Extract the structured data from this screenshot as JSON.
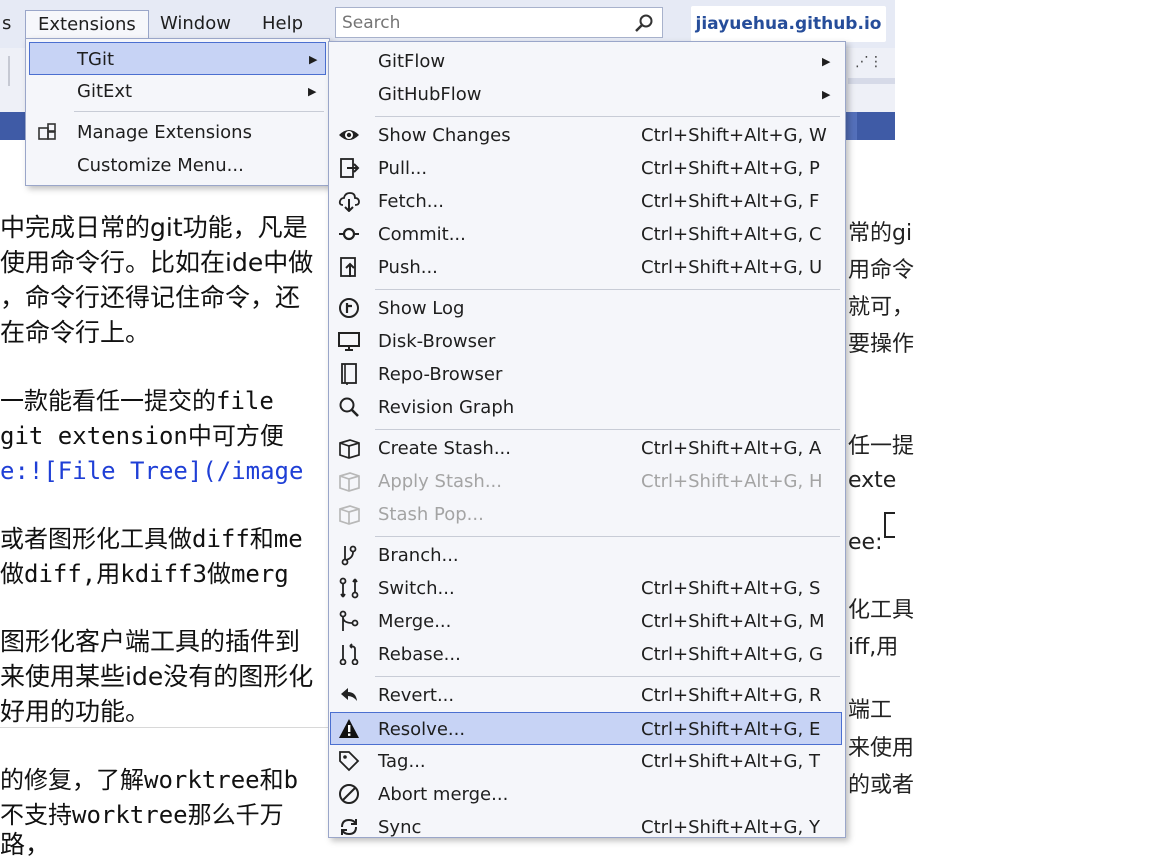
{
  "menubar": {
    "partial_left": "s",
    "items": [
      "Extensions",
      "Window",
      "Help"
    ],
    "search_placeholder": "Search",
    "badge": "jiayuehua.github.io"
  },
  "extensions_menu": {
    "items": [
      {
        "label": "TGit",
        "submenu": true,
        "highlighted": true
      },
      {
        "label": "GitExt",
        "submenu": true
      },
      {
        "label": "Manage Extensions",
        "icon": "extensions-icon"
      },
      {
        "label": "Customize Menu..."
      }
    ]
  },
  "tgit_menu": {
    "items": [
      {
        "label": "GitFlow",
        "submenu": true
      },
      {
        "label": "GitHubFlow",
        "submenu": true
      },
      {
        "label": "Show Changes",
        "shortcut": "Ctrl+Shift+Alt+G, W",
        "icon": "eye-icon"
      },
      {
        "label": "Pull...",
        "shortcut": "Ctrl+Shift+Alt+G, P",
        "icon": "pull-icon"
      },
      {
        "label": "Fetch...",
        "shortcut": "Ctrl+Shift+Alt+G, F",
        "icon": "cloud-download-icon"
      },
      {
        "label": "Commit...",
        "shortcut": "Ctrl+Shift+Alt+G, C",
        "icon": "commit-icon"
      },
      {
        "label": "Push...",
        "shortcut": "Ctrl+Shift+Alt+G, U",
        "icon": "push-icon"
      },
      {
        "label": "Show Log",
        "icon": "log-icon"
      },
      {
        "label": "Disk-Browser",
        "icon": "monitor-icon"
      },
      {
        "label": "Repo-Browser",
        "icon": "book-icon"
      },
      {
        "label": "Revision Graph",
        "icon": "magnifier-icon"
      },
      {
        "label": "Create Stash...",
        "shortcut": "Ctrl+Shift+Alt+G, A",
        "icon": "box-icon"
      },
      {
        "label": "Apply Stash...",
        "shortcut": "Ctrl+Shift+Alt+G, H",
        "icon": "box-icon",
        "disabled": true
      },
      {
        "label": "Stash Pop...",
        "icon": "box-icon",
        "disabled": true
      },
      {
        "label": "Branch...",
        "icon": "branch-icon"
      },
      {
        "label": "Switch...",
        "shortcut": "Ctrl+Shift+Alt+G, S",
        "icon": "switch-icon"
      },
      {
        "label": "Merge...",
        "shortcut": "Ctrl+Shift+Alt+G, M",
        "icon": "merge-icon"
      },
      {
        "label": "Rebase...",
        "shortcut": "Ctrl+Shift+Alt+G, G",
        "icon": "rebase-icon"
      },
      {
        "label": "Revert...",
        "shortcut": "Ctrl+Shift+Alt+G, R",
        "icon": "revert-icon"
      },
      {
        "label": "Resolve...",
        "shortcut": "Ctrl+Shift+Alt+G, E",
        "icon": "warning-icon",
        "highlighted": true
      },
      {
        "label": "Tag...",
        "shortcut": "Ctrl+Shift+Alt+G, T",
        "icon": "tag-icon"
      },
      {
        "label": "Abort merge...",
        "icon": "abort-icon"
      },
      {
        "label": "Sync",
        "shortcut": "Ctrl+Shift+Alt+G, Y",
        "icon": "sync-icon"
      }
    ]
  },
  "document": {
    "left_lines": [
      "中完成日常的git功能，凡是",
      "使用命令行。比如在ide中做",
      "，命令行还得记住命令，还",
      "在命令行上。",
      "一款能看任一提交的file",
      "git extension中可方便",
      "e:![File Tree](/image",
      "或者图形化工具做diff和me",
      "做diff,用kdiff3做merg",
      "图形化客户端工具的插件到",
      "来使用某些ide没有的图形化",
      "好用的功能。",
      "的修复，了解worktree和b",
      "不支持worktree那么千万",
      "路，"
    ],
    "right_fragments": [
      "常的gi",
      "用命令",
      "就可，",
      "要操作",
      "任一提",
      "exte",
      "ee:",
      "化工具",
      "iff,用",
      "端工",
      "来使用",
      "的或者"
    ]
  }
}
